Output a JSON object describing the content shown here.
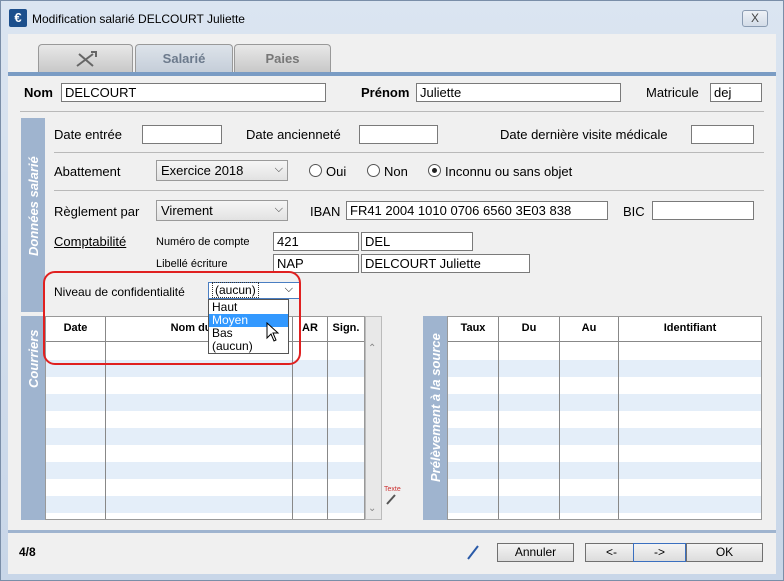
{
  "window": {
    "title": "Modification salarié DELCOURT Juliette",
    "close_glyph": "X",
    "app_icon": "€"
  },
  "tabs": [
    {
      "label": "",
      "icon": "tools-icon"
    },
    {
      "label": "Salarié"
    },
    {
      "label": "Paies"
    }
  ],
  "identity": {
    "nom_label": "Nom",
    "nom_value": "DELCOURT",
    "prenom_label": "Prénom",
    "prenom_value": "Juliette",
    "matricule_label": "Matricule",
    "matricule_value": "dej"
  },
  "donnees": {
    "section_title": "Données salarié",
    "date_entree_label": "Date entrée",
    "date_entree_value": "",
    "date_anciennete_label": "Date ancienneté",
    "date_anciennete_value": "",
    "date_visite_label": "Date dernière visite médicale",
    "date_visite_value": "",
    "abattement_label": "Abattement",
    "abattement_value": "Exercice 2018",
    "radio_oui": "Oui",
    "radio_non": "Non",
    "radio_inconnu": "Inconnu ou sans objet",
    "reglement_label": "Règlement par",
    "reglement_value": "Virement",
    "iban_label": "IBAN",
    "iban_value": "FR41 2004 1010 0706 6560 3E03 838",
    "bic_label": "BIC",
    "bic_value": "",
    "comptabilite_label": "Comptabilité",
    "numero_compte_label": "Numéro de compte",
    "numero_compte_value": "421",
    "numero_compte_value2": "DEL",
    "libelle_label": "Libellé écriture",
    "libelle_value": "NAP",
    "libelle_value2": "DELCOURT Juliette",
    "confidentialite_label": "Niveau de confidentialité",
    "confidentialite_value": "(aucun)",
    "confidentialite_options": [
      "Haut",
      "Moyen",
      "Bas",
      "(aucun)"
    ]
  },
  "courriers": {
    "section_title": "Courriers",
    "columns": [
      "Date",
      "Nom du co",
      "AR",
      "Sign."
    ],
    "texte_label": "Texte"
  },
  "prelevement": {
    "section_title": "Prélèvement à la source",
    "columns": [
      "Taux",
      "Du",
      "Au",
      "Identifiant"
    ]
  },
  "footer": {
    "page_counter": "4/8",
    "annuler": "Annuler",
    "prev": "<-",
    "next": "->",
    "ok": "OK"
  }
}
